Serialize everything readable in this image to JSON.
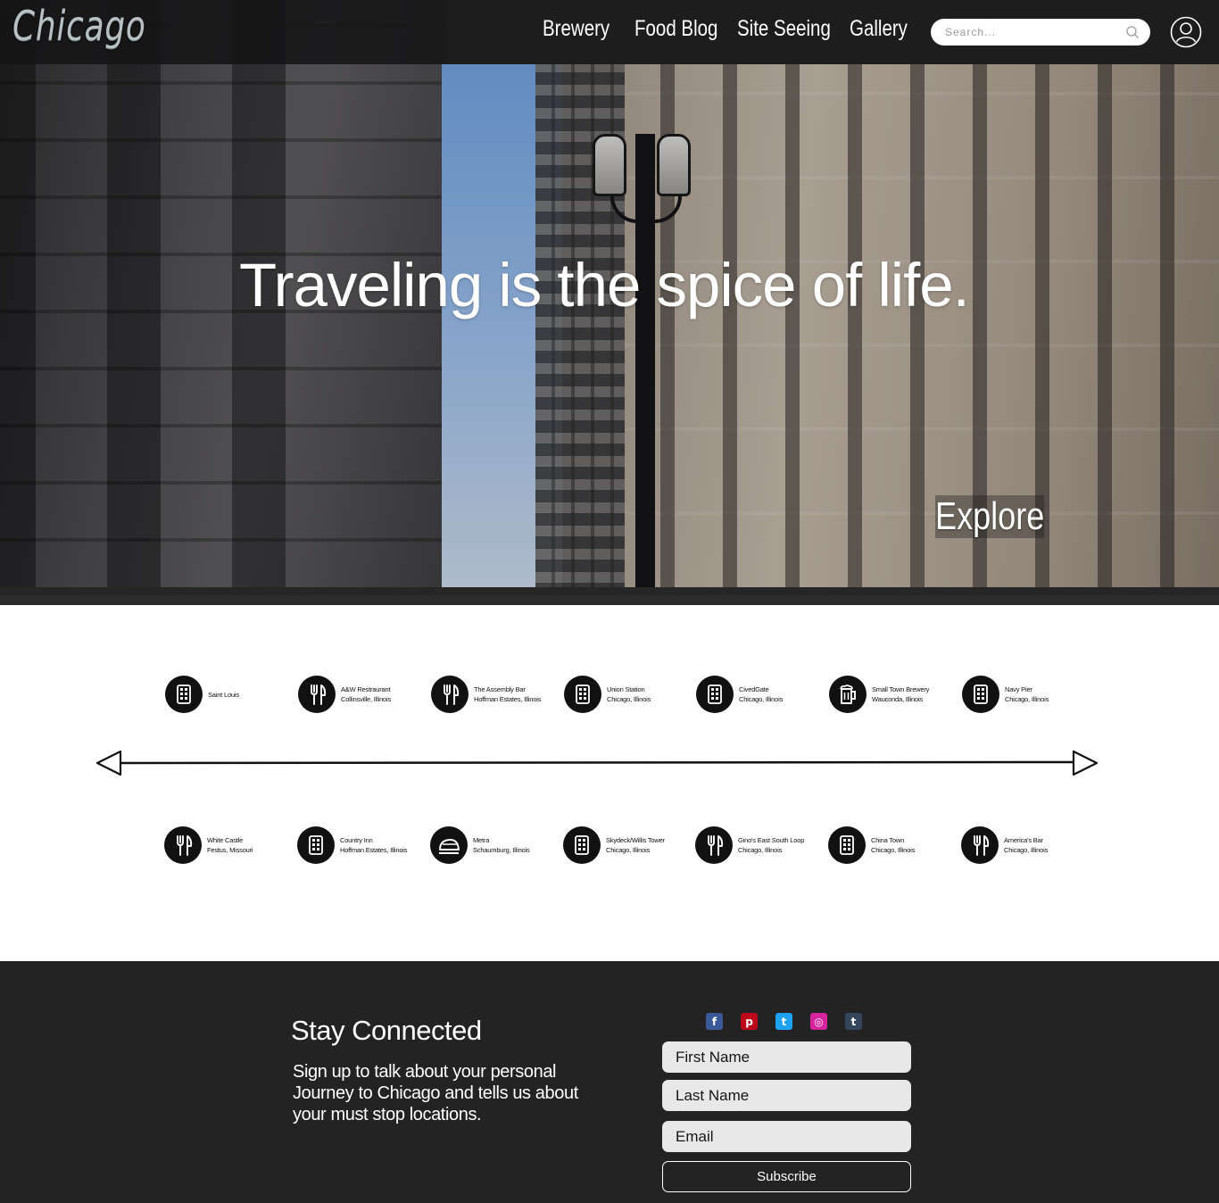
{
  "nav": {
    "logo": "Chicago",
    "links": [
      "Brewery",
      "Food Blog",
      "Site Seeing",
      "Gallery"
    ],
    "search_placeholder": "Search..."
  },
  "hero": {
    "tagline": "Traveling is the spice of life.",
    "cta_label": "Explore"
  },
  "locations": {
    "row1": [
      {
        "icon": "building-icon",
        "name": "Saint Louis",
        "place": ""
      },
      {
        "icon": "fork-knife-icon",
        "name": "A&W Restraurant",
        "place": "Collinsville, Illinois"
      },
      {
        "icon": "fork-knife-icon",
        "name": "The Assembly Bar",
        "place": "Hoffman Estates, Illinois"
      },
      {
        "icon": "building-icon",
        "name": "Union Station",
        "place": "Chicago, Illinois"
      },
      {
        "icon": "building-icon",
        "name": "CivedGate",
        "place": "Chicago, Illinois"
      },
      {
        "icon": "beer-mug-icon",
        "name": "Small Town Brewery",
        "place": "Wauconda, Illinois"
      },
      {
        "icon": "building-icon",
        "name": "Navy Pier",
        "place": "Chicago, Illinois"
      }
    ],
    "row2": [
      {
        "icon": "fork-knife-icon",
        "name": "White Castle",
        "place": "Festus, Missouri"
      },
      {
        "icon": "building-icon",
        "name": "Country Inn",
        "place": "Hoffman Estates, Illinois"
      },
      {
        "icon": "train-icon",
        "name": "Metra",
        "place": "Schaumburg, Illinois"
      },
      {
        "icon": "building-icon",
        "name": "Skydeck/Willis Tower",
        "place": "Chicago, Illinois"
      },
      {
        "icon": "fork-knife-icon",
        "name": "Gino's East South Loop",
        "place": "Chicago, Illinois"
      },
      {
        "icon": "building-icon",
        "name": "China Town",
        "place": "Chicago, Illinois"
      },
      {
        "icon": "fork-knife-icon",
        "name": "America's Bar",
        "place": "Chicago, Illinois"
      }
    ]
  },
  "footer": {
    "title": "Stay Connected",
    "body": "Sign up to talk about your personal Journey to Chicago and tells us about your must stop locations.",
    "socials": [
      {
        "icon": "facebook-icon",
        "glyph": "f",
        "color": "#3b5998"
      },
      {
        "icon": "pinterest-icon",
        "glyph": "p",
        "color": "#bd081c"
      },
      {
        "icon": "twitter-icon",
        "glyph": "t",
        "color": "#1da1f2"
      },
      {
        "icon": "instagram-icon",
        "glyph": "◎",
        "color": "#d6249f"
      },
      {
        "icon": "tumblr-icon",
        "glyph": "t",
        "color": "#35465c"
      }
    ],
    "first_name_placeholder": "First Name",
    "last_name_placeholder": "Last Name",
    "email_placeholder": "Email",
    "subscribe_label": "Subscribe"
  },
  "colors": {
    "navbar": "#141416",
    "footer": "#232323",
    "field_bg": "#e8e8e8"
  }
}
